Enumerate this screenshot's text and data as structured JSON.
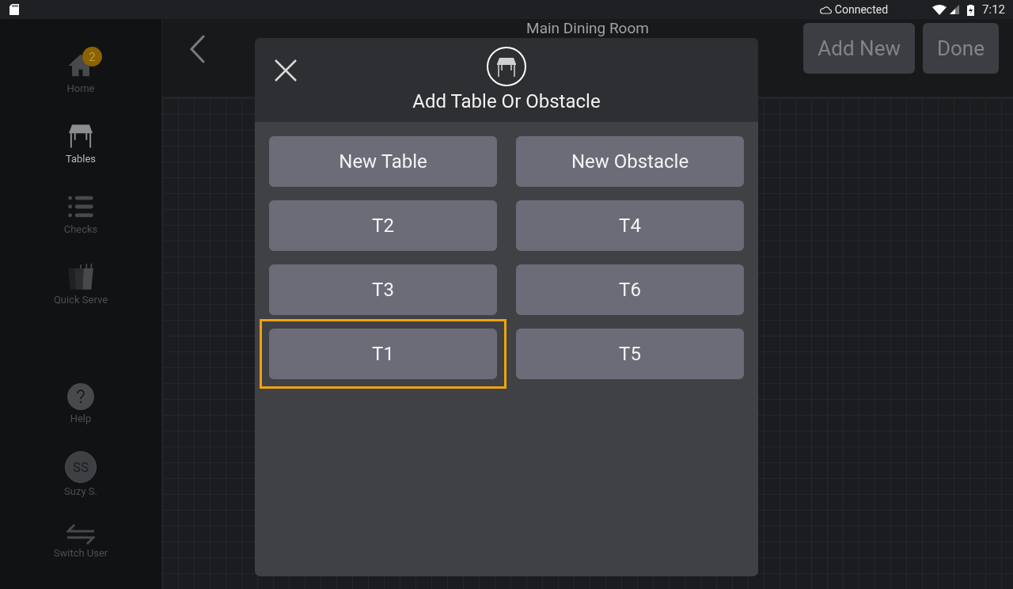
{
  "status_bar": {
    "connection": "Connected",
    "time": "7:12"
  },
  "sidebar": {
    "items": [
      {
        "label": "Home",
        "selected": false,
        "badge": "2"
      },
      {
        "label": "Tables",
        "selected": true
      },
      {
        "label": "Checks",
        "selected": false
      },
      {
        "label": "Quick Serve",
        "selected": false
      }
    ],
    "bottom_items": [
      {
        "kind": "help",
        "label": "Help"
      },
      {
        "kind": "avatar",
        "initials": "SS",
        "label": "Suzy S."
      },
      {
        "kind": "switch",
        "label": "Switch User"
      }
    ]
  },
  "header": {
    "title": "Main Dining Room",
    "buttons": [
      "Add New",
      "Done"
    ]
  },
  "dialog": {
    "title": "Add Table Or Obstacle",
    "options": [
      {
        "label": "New Table",
        "selected": false
      },
      {
        "label": "New Obstacle",
        "selected": false
      },
      {
        "label": "T2",
        "selected": false
      },
      {
        "label": "T4",
        "selected": false
      },
      {
        "label": "T3",
        "selected": false
      },
      {
        "label": "T6",
        "selected": false
      },
      {
        "label": "T1",
        "selected": true
      },
      {
        "label": "T5",
        "selected": false
      }
    ]
  }
}
